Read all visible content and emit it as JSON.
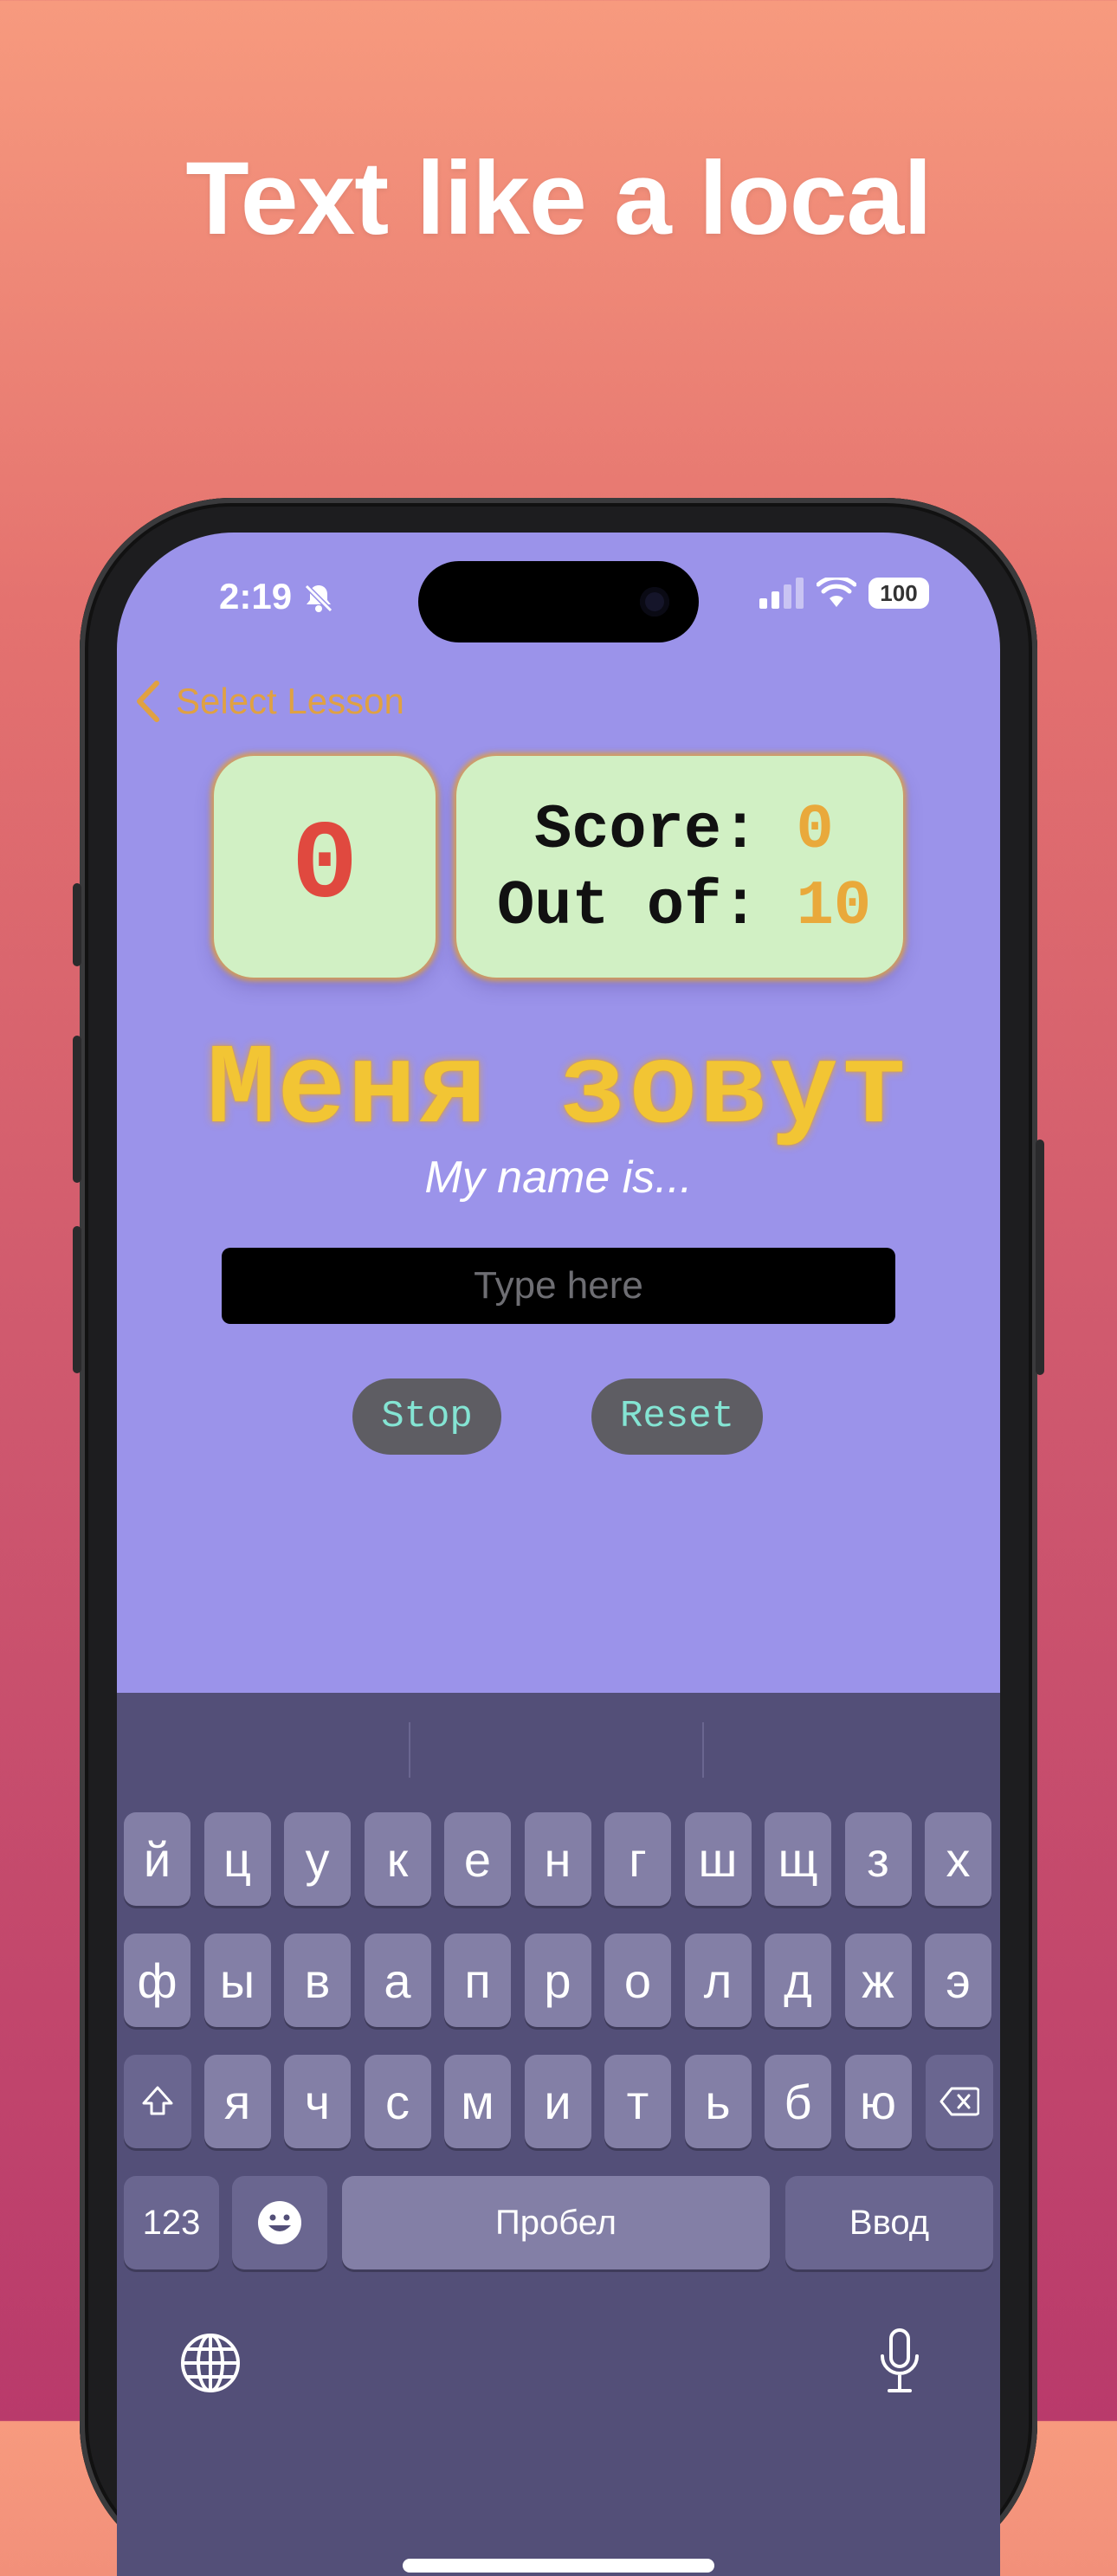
{
  "headline": "Text like a local",
  "status": {
    "time": "2:19",
    "battery": "100"
  },
  "nav": {
    "back_label": "Select Lesson"
  },
  "counter": "0",
  "score": {
    "score_label": "Score:",
    "score_value": "0",
    "out_of_label": "Out of:",
    "out_of_value": "10"
  },
  "lesson": {
    "word": "Меня зовут",
    "translation": "My name is..."
  },
  "input": {
    "placeholder": "Type here",
    "value": ""
  },
  "buttons": {
    "stop": "Stop",
    "reset": "Reset"
  },
  "keyboard": {
    "row1": [
      "й",
      "ц",
      "у",
      "к",
      "е",
      "н",
      "г",
      "ш",
      "щ",
      "з",
      "х"
    ],
    "row2": [
      "ф",
      "ы",
      "в",
      "а",
      "п",
      "р",
      "о",
      "л",
      "д",
      "ж",
      "э"
    ],
    "row3": [
      "я",
      "ч",
      "с",
      "м",
      "и",
      "т",
      "ь",
      "б",
      "ю"
    ],
    "numbers_key": "123",
    "space_key": "Пробел",
    "return_key": "Ввод"
  },
  "colors": {
    "accent": "#e0a142",
    "screen_bg": "#9b93ea",
    "box_bg": "#d1f0c4",
    "counter": "#e0493f",
    "word": "#f2c534",
    "pill_text": "#84e4d3"
  }
}
